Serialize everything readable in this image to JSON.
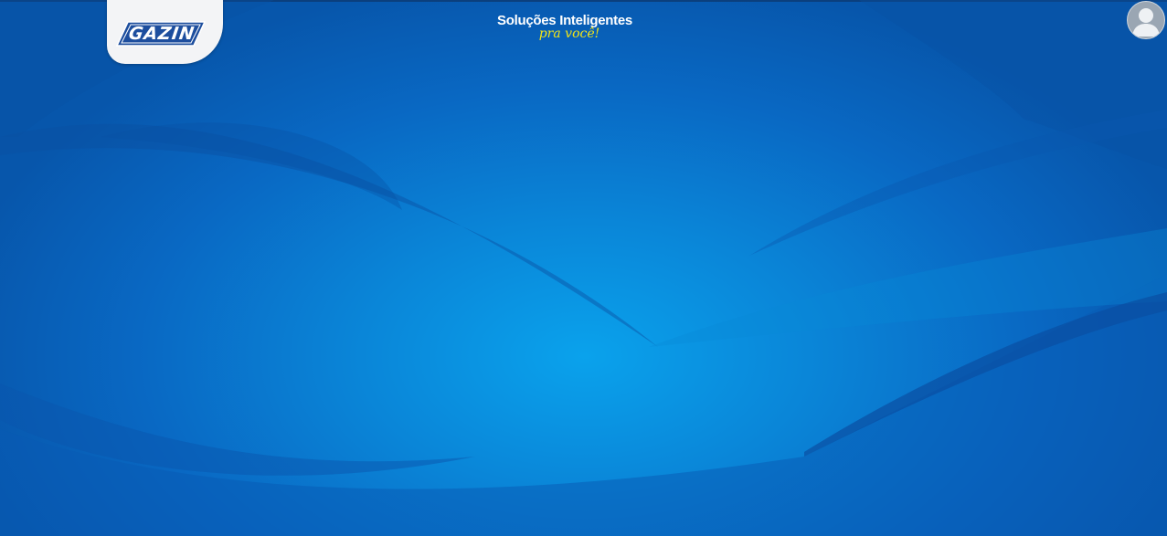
{
  "header": {
    "logo_text": "GAZIN",
    "slogan_title": "Soluções Inteligentes",
    "slogan_subtitle": "pra você!"
  },
  "user_menu": {
    "icon": "user-avatar-icon"
  },
  "colors": {
    "background_blue": "#0968c3",
    "background_glow": "#0aa2ec",
    "logo_blue": "#1d4e9e",
    "slogan_yellow": "#f3e516",
    "avatar_gray": "#9aa6b3"
  }
}
